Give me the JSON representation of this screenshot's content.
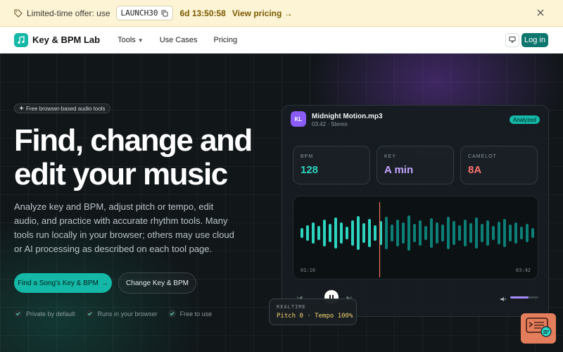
{
  "promo": {
    "text": "Limited-time offer: use",
    "code": "LAUNCH30",
    "timer": "6d 13:50:58",
    "view_label": "View pricing →"
  },
  "nav": {
    "brand": "Key & BPM Lab",
    "links": [
      {
        "label": "Tools",
        "dropdown": true
      },
      {
        "label": "Use Cases"
      },
      {
        "label": "Pricing"
      }
    ],
    "login_label": "Log in"
  },
  "hero": {
    "badge": "Free browser-based audio tools",
    "headline": "Find, change and edit your music",
    "subtext": "Analyze key and BPM, adjust pitch or tempo, edit audio, and practice with accurate rhythm tools. Many tools run locally in your browser; others may use cloud or AI processing as described on each tool page.",
    "cta_primary": "Find a Song's Key & BPM",
    "cta_secondary": "Change Key & BPM",
    "perks": [
      "Private by default",
      "Runs in your browser",
      "Free to use"
    ]
  },
  "player": {
    "avatar": "KL",
    "file_name": "Midnight Motion.mp3",
    "file_meta": "03:42 · Stereo",
    "status": "Analyzed",
    "metrics": [
      {
        "label": "BPM",
        "value": "128",
        "color": "#2dd4bf"
      },
      {
        "label": "KEY",
        "value": "A min",
        "color": "#c4a5ff"
      },
      {
        "label": "CAMELOT",
        "value": "8A",
        "color": "#f87171"
      }
    ],
    "time_current": "01:16",
    "time_total": "03:42",
    "progress": 0.342,
    "volume": 0.65
  },
  "realtime": {
    "label": "REALTIME",
    "value": "Pitch 0 · Tempo 100%"
  },
  "colors": {
    "accent": "#14b8a6",
    "purple": "#8b5cf6",
    "playhead": "#f0705a"
  }
}
